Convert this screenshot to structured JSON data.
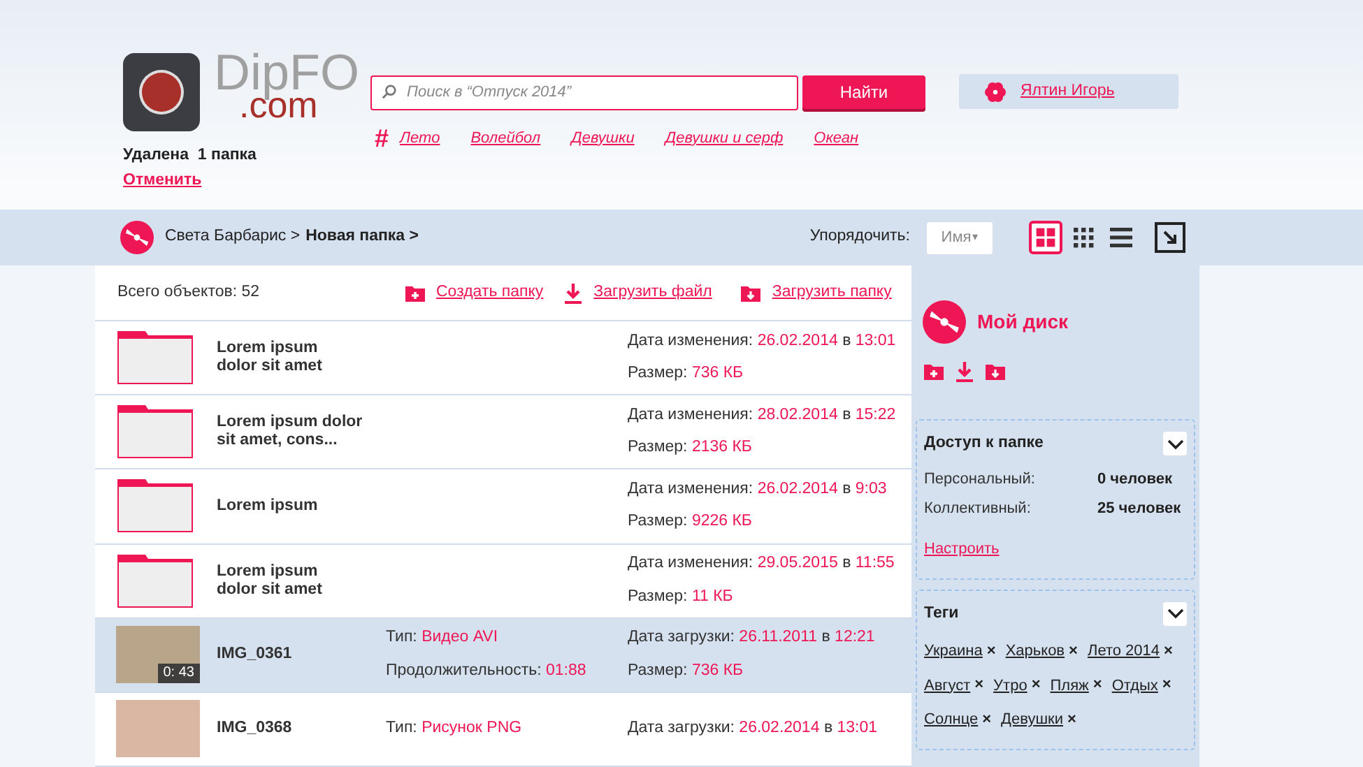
{
  "logo": {
    "name": "DipFO",
    "suffix": ".com"
  },
  "notice": {
    "text": "Удалена  1 папка",
    "action": "Отменить"
  },
  "search": {
    "placeholder": "Поиск в “Отпуск 2014”",
    "button": "Найти"
  },
  "tags_bar": {
    "symbol": "#",
    "tags": [
      "Лето",
      "Волейбол",
      "Девушки",
      "Девушки и серф",
      "Океан"
    ]
  },
  "user": {
    "name": "Ялтин Игорь"
  },
  "breadcrumb": {
    "parent": "Света Барбарис >",
    "current": "Новая папка >"
  },
  "sort": {
    "label": "Упорядочить:",
    "value": "Имя",
    "caret": "▾"
  },
  "views": [
    {
      "kind": "tiles",
      "selected": true
    },
    {
      "kind": "grid",
      "selected": false
    },
    {
      "kind": "list",
      "selected": false
    }
  ],
  "summary": "Всего объектов: 52",
  "actions": [
    {
      "kind": "new-folder",
      "label": "Создать папку"
    },
    {
      "kind": "upload-file",
      "label": "Загрузить файл"
    },
    {
      "kind": "upload-folder",
      "label": "Загрузить папку"
    }
  ],
  "rows": [
    {
      "kind": "folder",
      "selected": false,
      "name": "Lorem ipsum\ndolor sit amet",
      "date_label": "Дата изменения:",
      "date": "26.02.2014",
      "at": "в",
      "time": "13:01",
      "size_label": "Размер:",
      "size": "736 КБ"
    },
    {
      "kind": "folder",
      "selected": false,
      "name": "Lorem ipsum dolor\nsit amet,  cons...",
      "date_label": "Дата изменения:",
      "date": "28.02.2014",
      "at": "в",
      "time": "15:22",
      "size_label": "Размер:",
      "size": "2136 КБ"
    },
    {
      "kind": "folder",
      "selected": false,
      "name": "Lorem ipsum",
      "date_label": "Дата изменения:",
      "date": "26.02.2014",
      "at": "в",
      "time": "9:03",
      "size_label": "Размер:",
      "size": "9226 КБ"
    },
    {
      "kind": "folder",
      "selected": false,
      "name": "Lorem ipsum\ndolor sit amet",
      "date_label": "Дата изменения:",
      "date": "29.05.2015",
      "at": "в",
      "time": "11:55",
      "size_label": "Размер:",
      "size": "11 КБ"
    },
    {
      "kind": "video",
      "selected": true,
      "name": "IMG_0361",
      "duration_badge": "0: 43",
      "type_label": "Тип:",
      "type": "Видео AVI",
      "extra_label": "Продолжительность:",
      "extra": "01:88",
      "date_label": "Дата загрузки:",
      "date": "26.11.2011",
      "at": "в",
      "time": "12:21",
      "size_label": "Размер:",
      "size": "736 КБ"
    },
    {
      "kind": "image",
      "selected": false,
      "name": "IMG_0368",
      "type_label": "Тип:",
      "type": "Рисунок PNG",
      "date_label": "Дата загрузки:",
      "date": "26.02.2014",
      "at": "в",
      "time": "13:01"
    }
  ],
  "sidebar": {
    "title": "Мой диск",
    "access": {
      "title": "Доступ к папке",
      "expanded": false,
      "items": [
        {
          "label": "Персональный:",
          "value": "0 человек"
        },
        {
          "label": "Коллективный:",
          "value": "25 человек"
        }
      ],
      "link": "Настроить"
    },
    "tags": {
      "title": "Теги",
      "expanded": false,
      "remove": "×",
      "items": [
        "Украина",
        "Харьков",
        "Лето 2014",
        "Август",
        "Утро",
        "Пляж",
        "Отдых",
        "Солнце",
        "Девушки"
      ]
    }
  }
}
